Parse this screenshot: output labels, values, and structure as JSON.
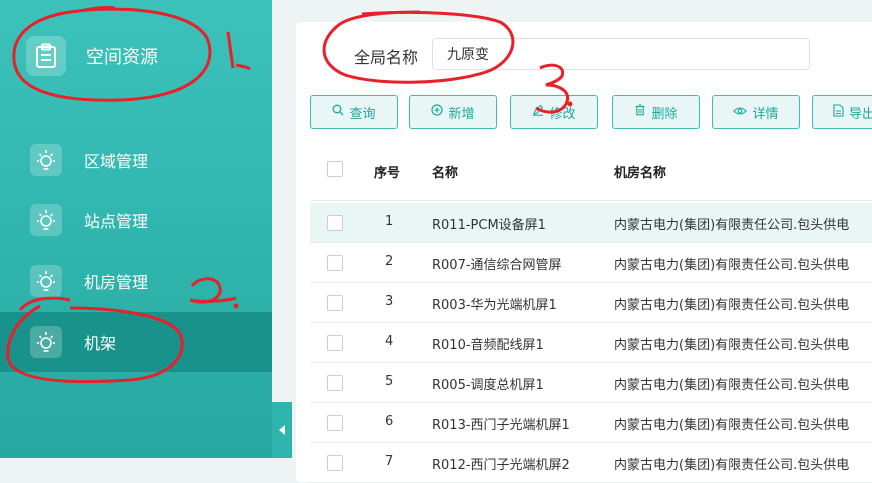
{
  "sidebar": {
    "header": {
      "label": "空间资源"
    },
    "items": [
      {
        "label": "区域管理"
      },
      {
        "label": "站点管理"
      },
      {
        "label": "机房管理"
      },
      {
        "label": "机架"
      }
    ]
  },
  "search": {
    "label": "全局名称",
    "value": "九原变"
  },
  "toolbar": {
    "query": "查询",
    "add": "新增",
    "edit": "修改",
    "delete": "删除",
    "details": "详情",
    "export": "导出"
  },
  "table": {
    "headers": {
      "index": "序号",
      "name": "名称",
      "room": "机房名称"
    },
    "rows": [
      {
        "index": "1",
        "name": "R011-PCM设备屏1",
        "room": "内蒙古电力(集团)有限责任公司.包头供电"
      },
      {
        "index": "2",
        "name": "R007-通信综合网管屏",
        "room": "内蒙古电力(集团)有限责任公司.包头供电"
      },
      {
        "index": "3",
        "name": "R003-华为光端机屏1",
        "room": "内蒙古电力(集团)有限责任公司.包头供电"
      },
      {
        "index": "4",
        "name": "R010-音频配线屏1",
        "room": "内蒙古电力(集团)有限责任公司.包头供电"
      },
      {
        "index": "5",
        "name": "R005-调度总机屏1",
        "room": "内蒙古电力(集团)有限责任公司.包头供电"
      },
      {
        "index": "6",
        "name": "R013-西门子光端机屏1",
        "room": "内蒙古电力(集团)有限责任公司.包头供电"
      },
      {
        "index": "7",
        "name": "R012-西门子光端机屏2",
        "room": "内蒙古电力(集团)有限责任公司.包头供电"
      }
    ]
  },
  "annotations": {
    "n1": "1.",
    "n2": "2.",
    "n3": "3."
  },
  "colors": {
    "accent": "#2fb5ad",
    "active": "#19928b",
    "annotation": "#e8202a"
  }
}
